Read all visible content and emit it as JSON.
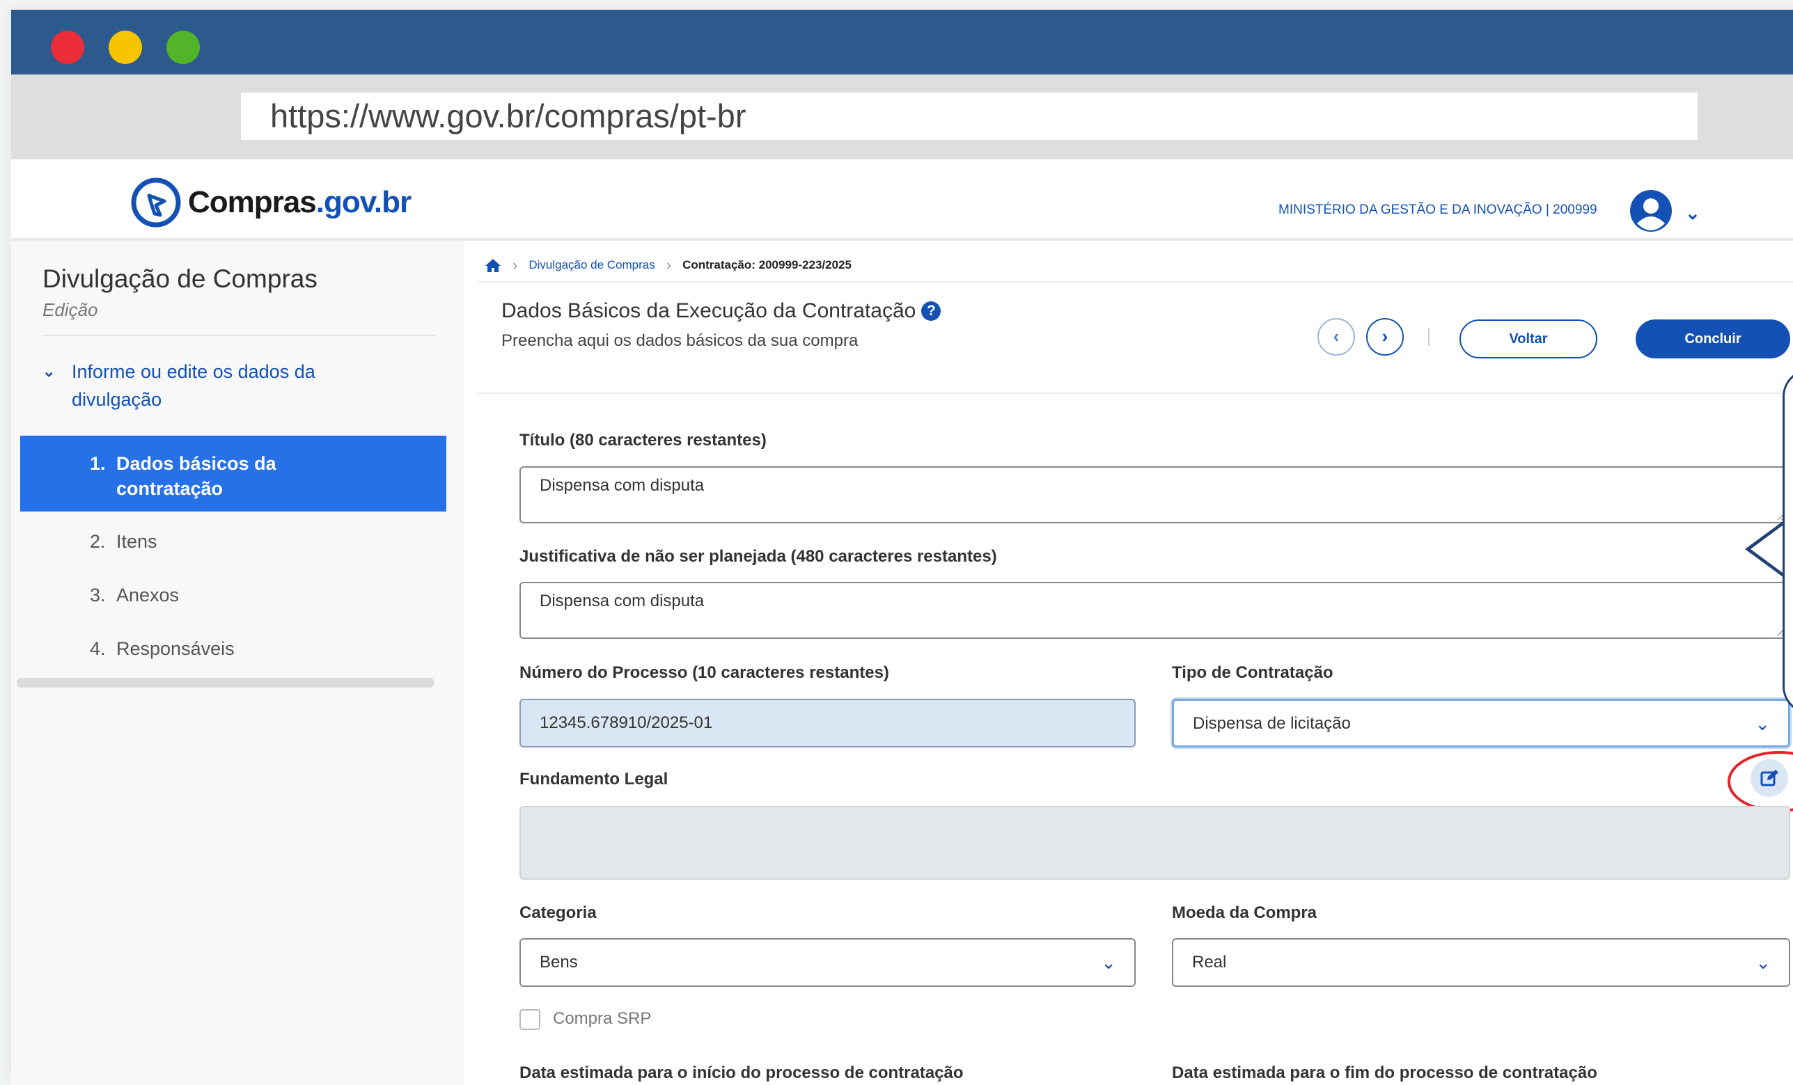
{
  "browser": {
    "url": "https://www.gov.br/compras/pt-br"
  },
  "header": {
    "logo_main": "Compras",
    "logo_gov": ".gov.br",
    "ministry": "MINISTÉRIO DA GESTÃO E DA INOVAÇÃO | 200999"
  },
  "sidebar": {
    "title": "Divulgação de Compras",
    "subtitle": "Edição",
    "section": "Informe ou edite os dados da divulgação",
    "items": [
      {
        "num": "1.",
        "label": "Dados básicos da contratação"
      },
      {
        "num": "2.",
        "label": "Itens"
      },
      {
        "num": "3.",
        "label": "Anexos"
      },
      {
        "num": "4.",
        "label": "Responsáveis"
      }
    ]
  },
  "breadcrumb": {
    "link": "Divulgação de Compras",
    "current": "Contratação: 200999-223/2025"
  },
  "page": {
    "title": "Dados Básicos da Execução da Contratação",
    "subtitle": "Preencha aqui os dados básicos da sua compra",
    "voltar": "Voltar",
    "concluir": "Concluir"
  },
  "form": {
    "titulo_label": "Título (80 caracteres restantes)",
    "titulo_value": "Dispensa com disputa",
    "justificativa_label": "Justificativa de não ser planejada (480 caracteres restantes)",
    "justificativa_value": "Dispensa com disputa",
    "processo_label": "Número do Processo (10 caracteres restantes)",
    "processo_value": "12345.678910/2025-01",
    "tipo_label": "Tipo de Contratação",
    "tipo_value": "Dispensa de licitação",
    "fundamento_label": "Fundamento Legal",
    "categoria_label": "Categoria",
    "categoria_value": "Bens",
    "moeda_label": "Moeda da Compra",
    "moeda_value": "Real",
    "srp_label": "Compra SRP",
    "data_inicio_label": "Data estimada para o início do processo de contratação",
    "data_fim_label": "Data estimada para o fim do processo de contratação"
  },
  "colors": {
    "primary": "#1351b4",
    "active_sidebar": "#2670e8",
    "chrome": "#2c5a8c",
    "highlight": "#e0242c"
  }
}
